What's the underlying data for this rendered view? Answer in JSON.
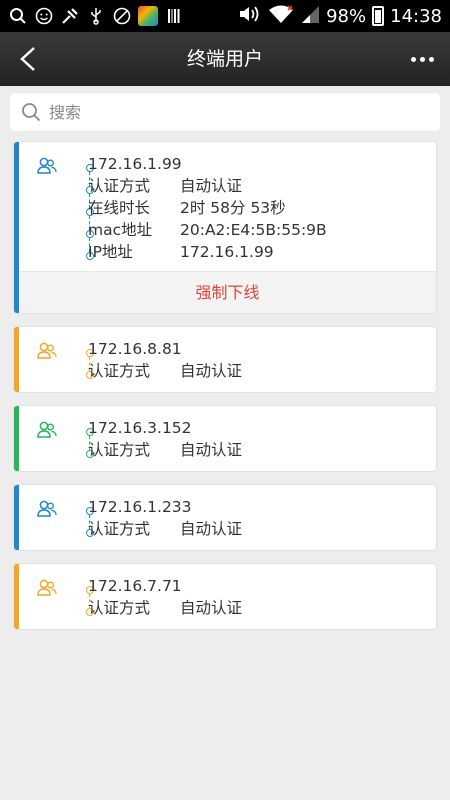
{
  "status_bar": {
    "battery": "98%",
    "time": "14:38",
    "left_icons": [
      "search-icon",
      "smiley-icon",
      "tool-icon",
      "usb-icon",
      "mute-icon",
      "app-icon",
      "barcode-icon"
    ],
    "right_icons": [
      "volume-icon",
      "wifi-icon",
      "signal-icon",
      "battery-icon"
    ]
  },
  "header": {
    "title": "终端用户",
    "back_icon": "chevron-left-icon",
    "more_icon": "more-icon"
  },
  "search": {
    "placeholder": "搜索",
    "icon": "search-icon"
  },
  "colors": {
    "blue": "#1e88c8",
    "orange": "#f5a623",
    "green": "#27b55a",
    "danger": "#e0453b",
    "header_bg": "#2d2d2d",
    "page_bg": "#ededed"
  },
  "users": [
    {
      "ip": "172.16.1.99",
      "color": "#1e88c8",
      "expanded": true,
      "fields": [
        {
          "label": "认证方式",
          "value": "自动认证"
        },
        {
          "label": "在线时长",
          "value": "2时 58分 53秒"
        },
        {
          "label": "mac地址",
          "value": "20:A2:E4:5B:55:9B"
        },
        {
          "label": "IP地址",
          "value": "172.16.1.99"
        }
      ],
      "action": "强制下线"
    },
    {
      "ip": "172.16.8.81",
      "color": "#f5a623",
      "expanded": false,
      "fields": [
        {
          "label": "认证方式",
          "value": "自动认证"
        }
      ]
    },
    {
      "ip": "172.16.3.152",
      "color": "#27b55a",
      "expanded": false,
      "fields": [
        {
          "label": "认证方式",
          "value": "自动认证"
        }
      ]
    },
    {
      "ip": "172.16.1.233",
      "color": "#1e88c8",
      "expanded": false,
      "fields": [
        {
          "label": "认证方式",
          "value": "自动认证"
        }
      ]
    },
    {
      "ip": "172.16.7.71",
      "color": "#f5a623",
      "expanded": false,
      "fields": [
        {
          "label": "认证方式",
          "value": "自动认证"
        }
      ]
    }
  ]
}
